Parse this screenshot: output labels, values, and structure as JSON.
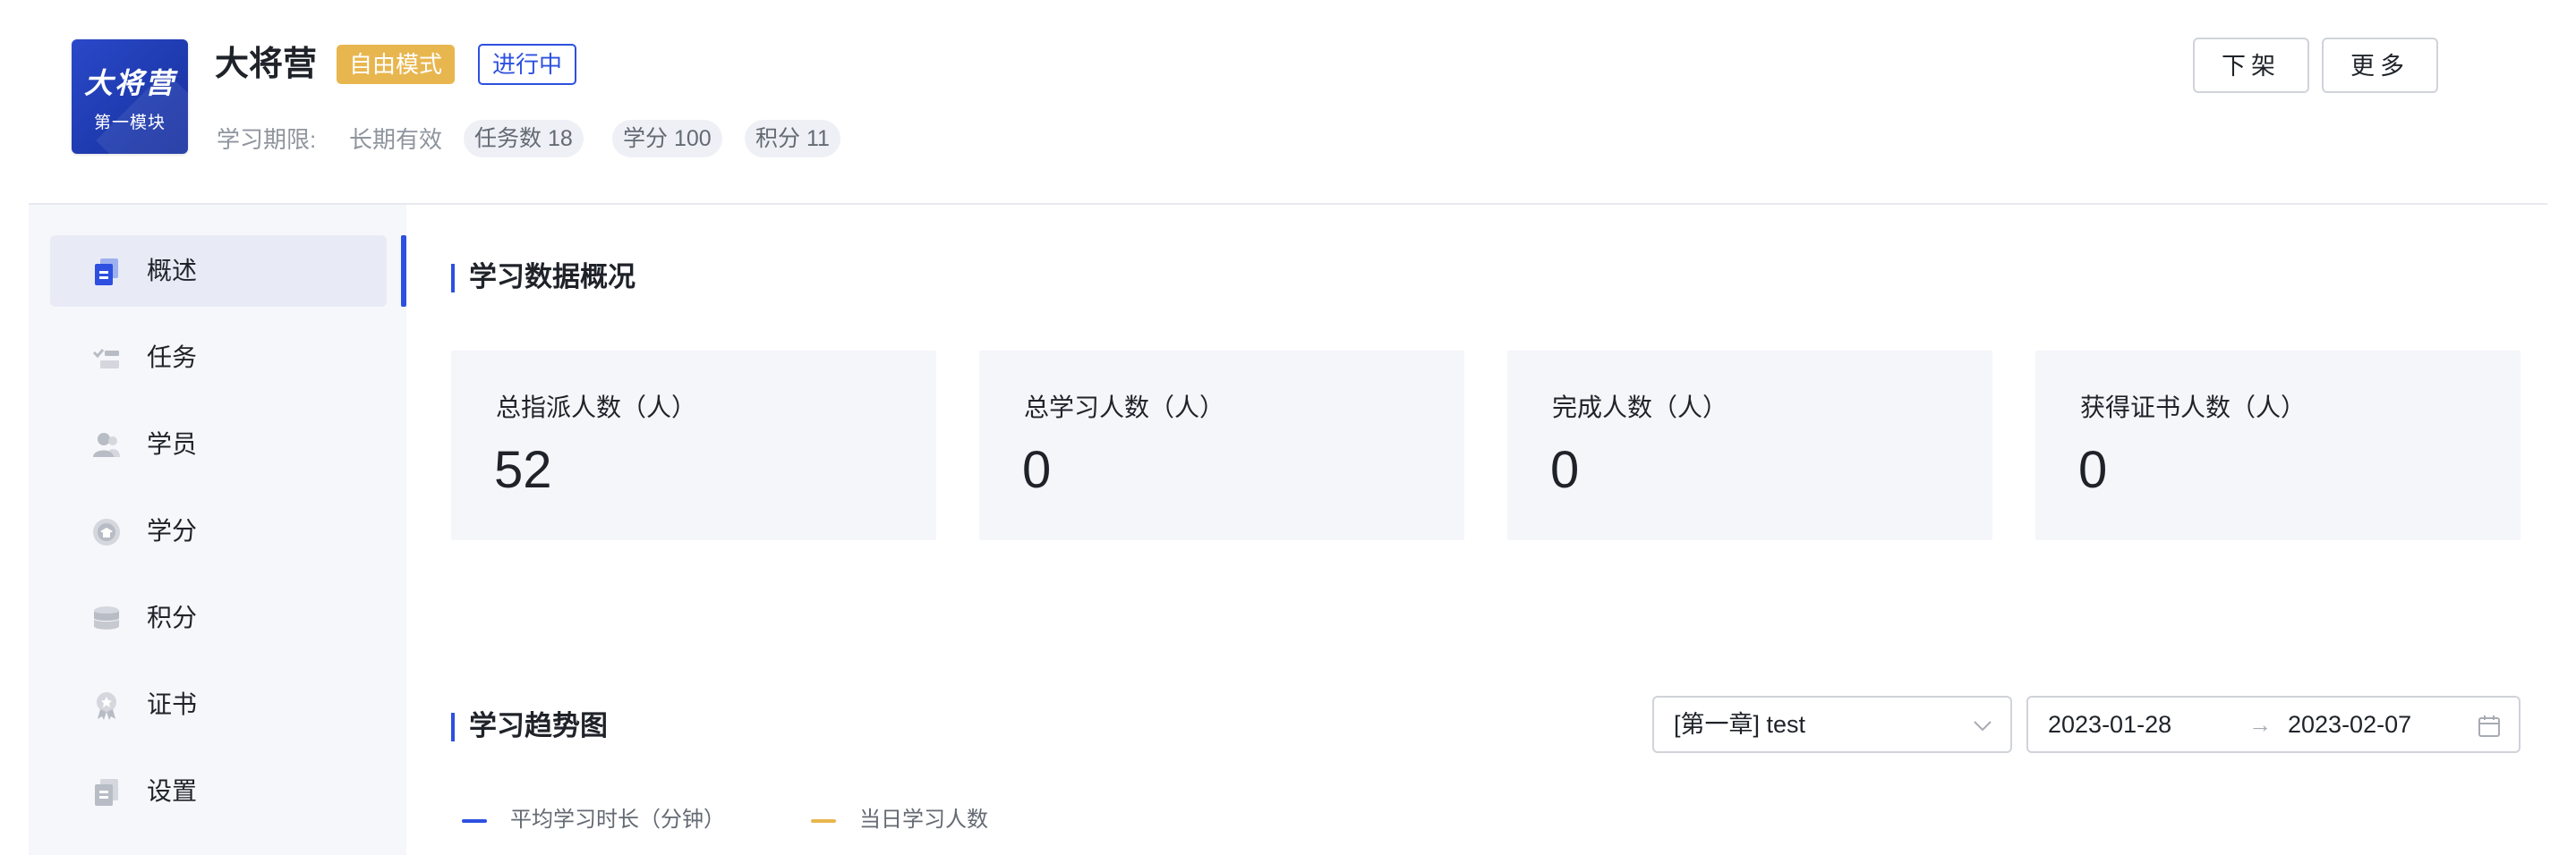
{
  "header": {
    "cover": {
      "title": "大将营",
      "subtitle": "第一模块"
    },
    "title": "大将营",
    "mode_tag": "自由模式",
    "status_tag": "进行中",
    "period_label": "学习期限:",
    "period_value": "长期有效",
    "chips": {
      "tasks": "任务数 18",
      "credits": "学分 100",
      "points": "积分 11"
    },
    "buttons": {
      "offshelf": "下架",
      "more": "更多"
    }
  },
  "sidebar": {
    "items": [
      {
        "label": "概述",
        "icon": "overview-icon",
        "active": true
      },
      {
        "label": "任务",
        "icon": "task-icon",
        "active": false
      },
      {
        "label": "学员",
        "icon": "student-icon",
        "active": false
      },
      {
        "label": "学分",
        "icon": "credit-icon",
        "active": false
      },
      {
        "label": "积分",
        "icon": "points-icon",
        "active": false
      },
      {
        "label": "证书",
        "icon": "certificate-icon",
        "active": false
      },
      {
        "label": "设置",
        "icon": "settings-icon",
        "active": false
      }
    ]
  },
  "overview": {
    "title": "学习数据概况",
    "cards": [
      {
        "label": "总指派人数（人）",
        "value": "52"
      },
      {
        "label": "总学习人数（人）",
        "value": "0"
      },
      {
        "label": "完成人数（人）",
        "value": "0"
      },
      {
        "label": "获得证书人数（人）",
        "value": "0"
      }
    ]
  },
  "trend": {
    "title": "学习趋势图",
    "chapter_select": "[第一章] test",
    "date_start": "2023-01-28",
    "date_separator": "→",
    "date_end": "2023-02-07",
    "legend": [
      {
        "label": "平均学习时长（分钟）",
        "color": "#2d50e0"
      },
      {
        "label": "当日学习人数",
        "color": "#e8b64f"
      }
    ]
  },
  "colors": {
    "accent": "#2d50e0",
    "mode_tag": "#e8b64f",
    "sidebar_bg": "#f6f7fb",
    "card_bg": "#f5f6fa"
  }
}
